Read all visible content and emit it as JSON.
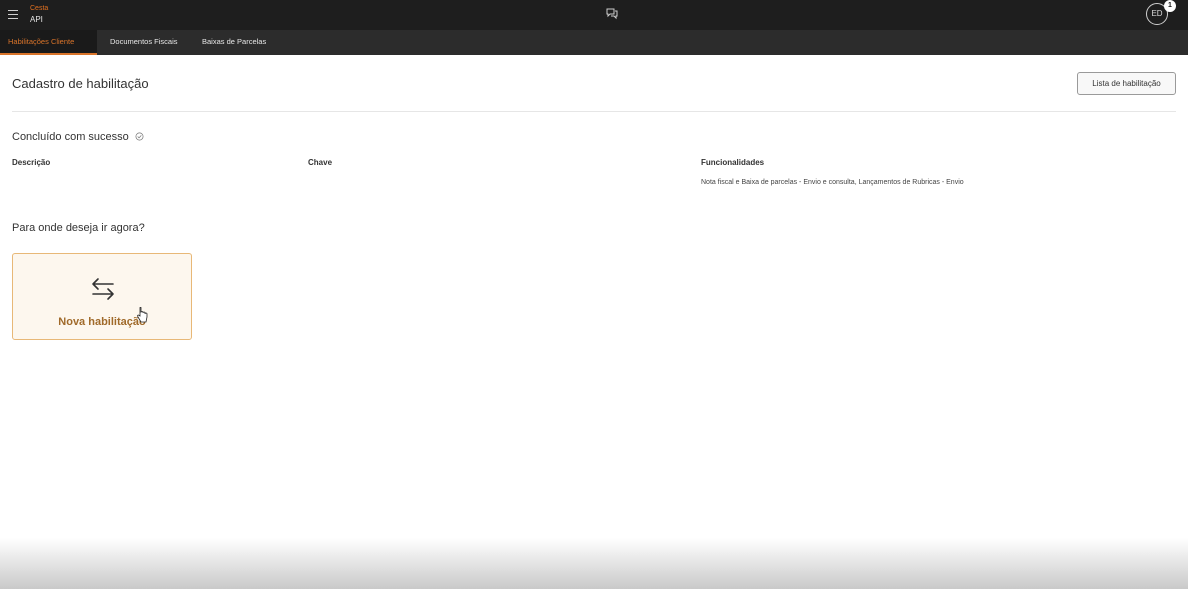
{
  "header": {
    "brand_small": "Cesta",
    "brand_name": "API",
    "avatar_initials": "ED",
    "notification_count": "1"
  },
  "tabs": [
    {
      "label": "Habilitações Cliente",
      "active": true
    },
    {
      "label": "Documentos Fiscais",
      "active": false
    },
    {
      "label": "Baixas de Parcelas",
      "active": false
    }
  ],
  "page": {
    "title": "Cadastro de habilitação",
    "list_button": "Lista de habilitação"
  },
  "result": {
    "status": "Concluído com sucesso",
    "columns": {
      "description": "Descrição",
      "key": "Chave",
      "features": "Funcionalidades"
    },
    "values": {
      "description": "",
      "key": "",
      "features": "Nota fiscal e Baixa de parcelas - Envio e consulta, Lançamentos de Rubricas - Envio"
    }
  },
  "next": {
    "question": "Para onde deseja ir agora?",
    "card_label": "Nova habilitação"
  },
  "colors": {
    "accent": "#d9742a",
    "card_bg": "#fdf7ee",
    "card_border": "#e8b877"
  }
}
